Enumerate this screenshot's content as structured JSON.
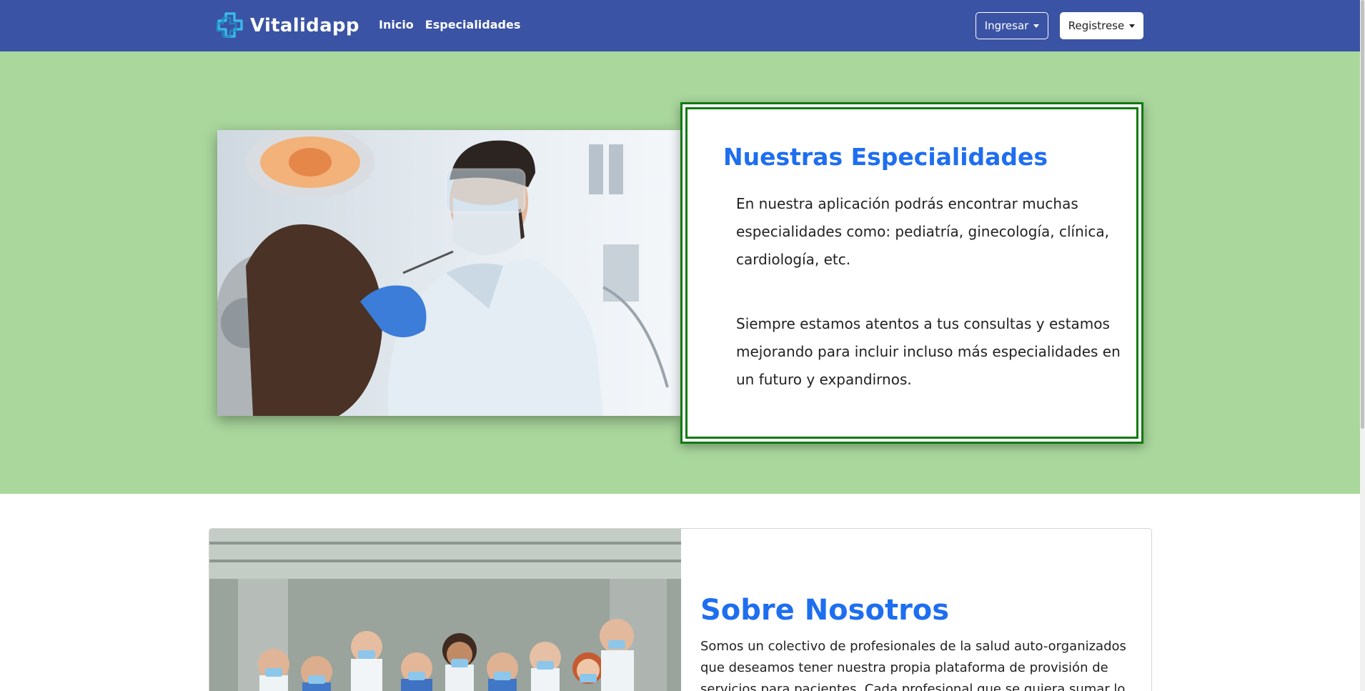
{
  "navbar": {
    "brand_name": "Vitalidapp",
    "links": [
      "Inicio",
      "Especialidades"
    ],
    "ingresar_label": "Ingresar",
    "registrese_label": "Registrese",
    "color": "#3a53a4"
  },
  "hero": {
    "background_color": "#a9d79c",
    "image_description_icon": "dentist-photo",
    "card": {
      "title": "Nuestras Especialidades",
      "paragraph_1": "En nuestra aplicación podrás encontrar muchas especialidades como: pediatría, ginecología, clínica, cardiología, etc.",
      "paragraph_2": "Siempre estamos atentos a tus consultas y estamos mejorando para incluir incluso más especialidades en un futuro y expandirnos.",
      "border_color": "#0f7a10",
      "title_color": "#1e6ef0"
    }
  },
  "about": {
    "image_icon": "medical-team-photo",
    "title": "Sobre Nosotros",
    "text": "Somos un colectivo de profesionales de la salud auto-organizados que deseamos tener nuestra propia plataforma de provisión de servicios para pacientes. Cada profesional que se quiera sumar lo"
  }
}
